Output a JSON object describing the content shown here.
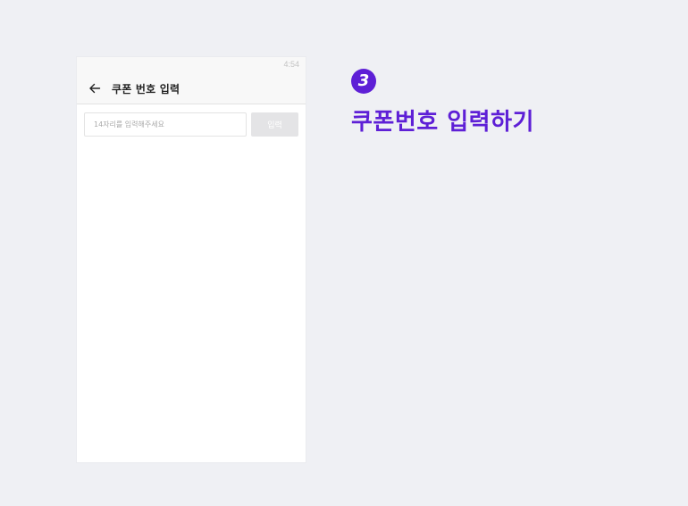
{
  "phone": {
    "status_bar": {
      "time": "4:54"
    },
    "header": {
      "back_icon": "arrow-left-icon",
      "title": "쿠폰 번호 입력"
    },
    "coupon_form": {
      "input_value": "",
      "input_placeholder": "14자리를 입력해주세요",
      "submit_label": "입력",
      "submit_enabled": false
    }
  },
  "annotation": {
    "step_number": "3",
    "step_title": "쿠폰번호 입력하기"
  },
  "colors": {
    "accent": "#5e1fd6",
    "background": "#eff0f4",
    "disabled_button": "#e4e4e6"
  }
}
